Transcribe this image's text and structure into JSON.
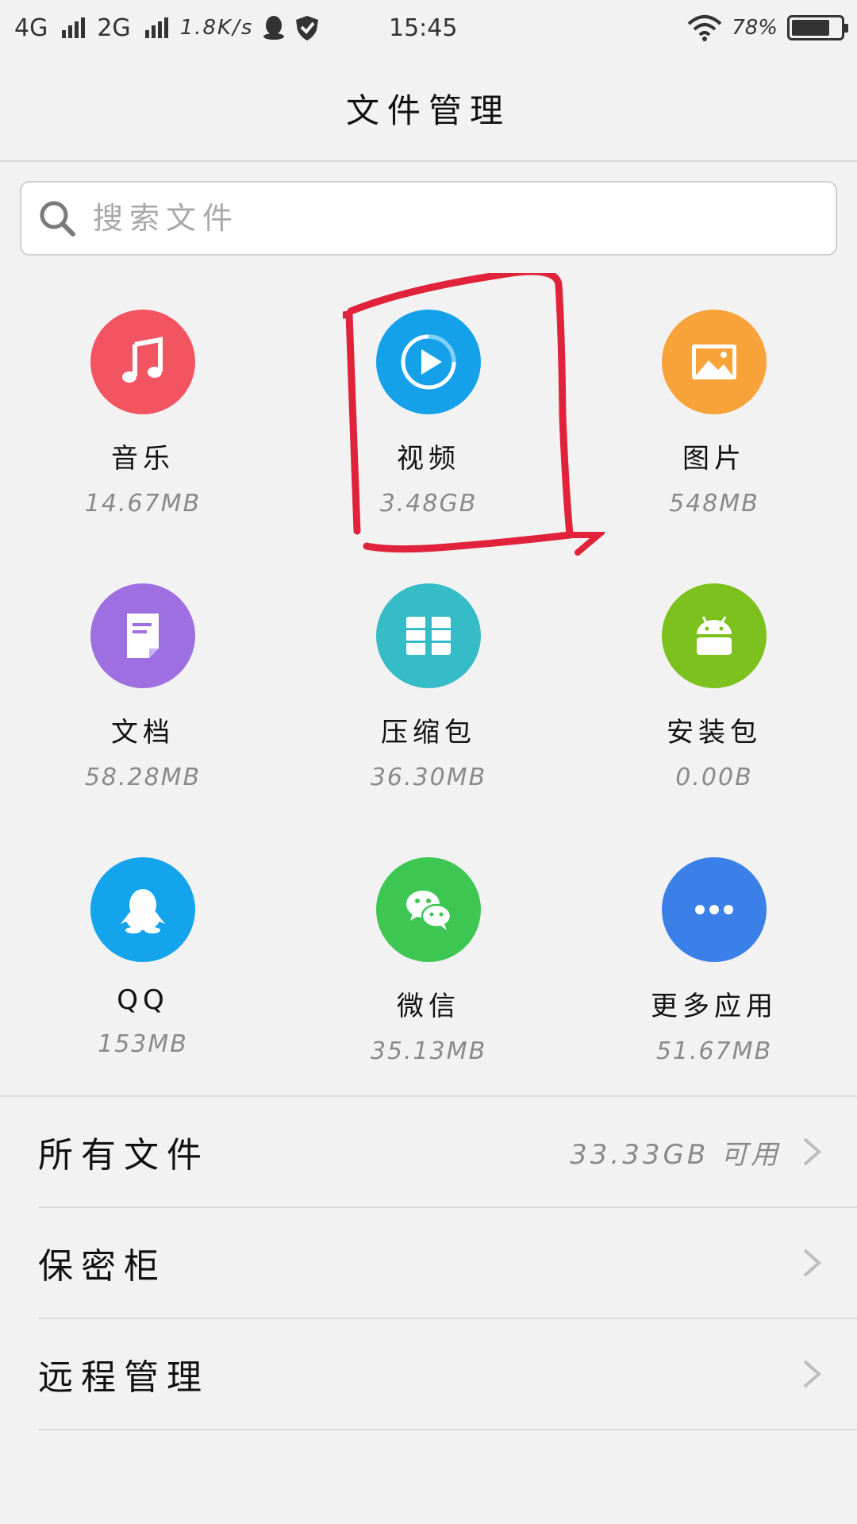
{
  "status_bar": {
    "network1": "4G",
    "network2": "2G",
    "speed": "1.8K/s",
    "time": "15:45",
    "battery": "78%",
    "battery_level": 0.78
  },
  "header": {
    "title": "文件管理"
  },
  "search": {
    "placeholder": "搜索文件"
  },
  "categories": [
    {
      "name": "音乐",
      "size": "14.67MB",
      "icon": "music-icon",
      "color": "#f25561"
    },
    {
      "name": "视频",
      "size": "3.48GB",
      "icon": "video-play-icon",
      "color": "#15a1ea"
    },
    {
      "name": "图片",
      "size": "548MB",
      "icon": "image-icon",
      "color": "#f8a23a"
    },
    {
      "name": "文档",
      "size": "58.28MB",
      "icon": "document-icon",
      "color": "#9e6fe0"
    },
    {
      "name": "压缩包",
      "size": "36.30MB",
      "icon": "archive-icon",
      "color": "#35bcc6"
    },
    {
      "name": "安装包",
      "size": "0.00B",
      "icon": "android-icon",
      "color": "#7dc11e"
    },
    {
      "name": "QQ",
      "size": "153MB",
      "icon": "qq-penguin-icon",
      "color": "#14a4ec"
    },
    {
      "name": "微信",
      "size": "35.13MB",
      "icon": "wechat-icon",
      "color": "#3ec653"
    },
    {
      "name": "更多应用",
      "size": "51.67MB",
      "icon": "more-dots-icon",
      "color": "#3b7fe9"
    }
  ],
  "list": [
    {
      "label": "所有文件",
      "value": "33.33GB 可用"
    },
    {
      "label": "保密柜",
      "value": ""
    },
    {
      "label": "远程管理",
      "value": ""
    }
  ],
  "annotation_color": "#e0233a"
}
